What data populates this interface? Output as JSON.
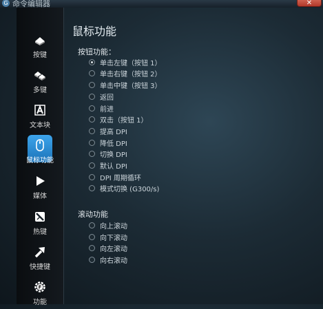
{
  "window": {
    "title": "命令编辑器",
    "close_label": "✕"
  },
  "sidebar": {
    "items": [
      {
        "label": "按键",
        "icon": "key-icon"
      },
      {
        "label": "多键",
        "icon": "multi-key-icon"
      },
      {
        "label": "文本块",
        "icon": "text-block-icon"
      },
      {
        "label": "鼠标功能",
        "icon": "mouse-icon",
        "active": true
      },
      {
        "label": "媒体",
        "icon": "play-icon"
      },
      {
        "label": "热键",
        "icon": "hotkey-icon"
      },
      {
        "label": "快捷键",
        "icon": "shortcut-arrow-icon"
      },
      {
        "label": "功能",
        "icon": "function-gear-icon"
      }
    ]
  },
  "main": {
    "title": "鼠标功能",
    "button_section": {
      "title": "按钮功能：",
      "options": [
        {
          "label": "单击左键（按钮 1）",
          "checked": true
        },
        {
          "label": "单击右键（按钮 2）",
          "checked": false
        },
        {
          "label": "单击中键（按钮 3）",
          "checked": false
        },
        {
          "label": "返回",
          "checked": false
        },
        {
          "label": "前进",
          "checked": false
        },
        {
          "label": "双击（按钮 1）",
          "checked": false
        },
        {
          "label": "提高 DPI",
          "checked": false
        },
        {
          "label": "降低 DPI",
          "checked": false
        },
        {
          "label": "切换 DPI",
          "checked": false
        },
        {
          "label": "默认 DPI",
          "checked": false
        },
        {
          "label": "DPI 周期循环",
          "checked": false
        },
        {
          "label": "模式切换 (G300/s)",
          "checked": false
        }
      ]
    },
    "scroll_section": {
      "title": "滚动功能",
      "options": [
        {
          "label": "向上滚动",
          "checked": false
        },
        {
          "label": "向下滚动",
          "checked": false
        },
        {
          "label": "向左滚动",
          "checked": false
        },
        {
          "label": "向右滚动",
          "checked": false
        }
      ]
    }
  },
  "colors": {
    "accent": "#2a8ad6",
    "background": "#1c2b35",
    "sidebar": "#0e1216"
  }
}
